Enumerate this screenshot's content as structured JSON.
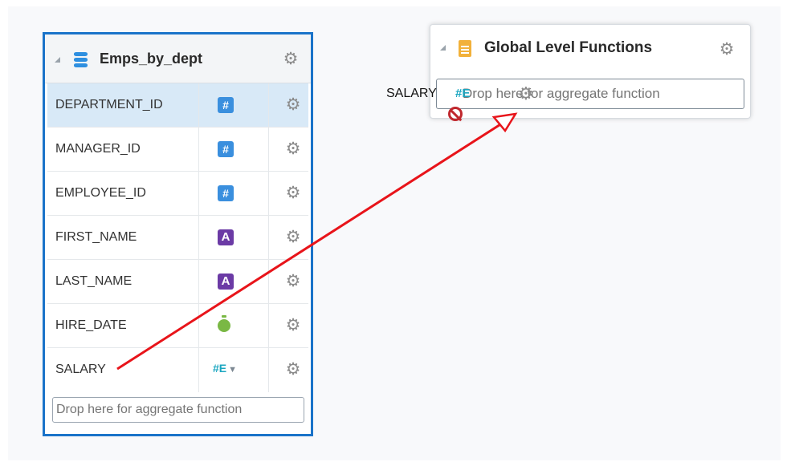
{
  "emps_card": {
    "title": "Emps_by_dept",
    "icon": "database-icon",
    "rows": [
      {
        "name": "DEPARTMENT_ID",
        "type": "number",
        "type_label": "#",
        "selected": true
      },
      {
        "name": "MANAGER_ID",
        "type": "number",
        "type_label": "#",
        "selected": false
      },
      {
        "name": "EMPLOYEE_ID",
        "type": "number",
        "type_label": "#",
        "selected": false
      },
      {
        "name": "FIRST_NAME",
        "type": "string",
        "type_label": "A",
        "selected": false
      },
      {
        "name": "LAST_NAME",
        "type": "string",
        "type_label": "A",
        "selected": false
      },
      {
        "name": "HIRE_DATE",
        "type": "date",
        "type_label": "",
        "selected": false
      },
      {
        "name": "SALARY",
        "type": "hash-expression",
        "type_label": "#E",
        "selected": false
      }
    ],
    "drop_placeholder": "Drop here for aggregate function"
  },
  "global_card": {
    "title": "Global Level Functions",
    "icon": "document-icon",
    "drop_placeholder": "Drop here for aggregate function"
  },
  "drag_ghost": {
    "label": "SALARY",
    "type_label": "#E",
    "status": "not-allowed"
  },
  "colors": {
    "selection_border": "#1a73c9",
    "selected_row": "#d8e9f7",
    "number_badge": "#3a8fde",
    "string_badge": "#6b3aa5",
    "date_icon": "#7ab844",
    "hash_expression": "#1aa6c0",
    "arrow": "#e8141a",
    "no_drop": "#c0282e"
  }
}
